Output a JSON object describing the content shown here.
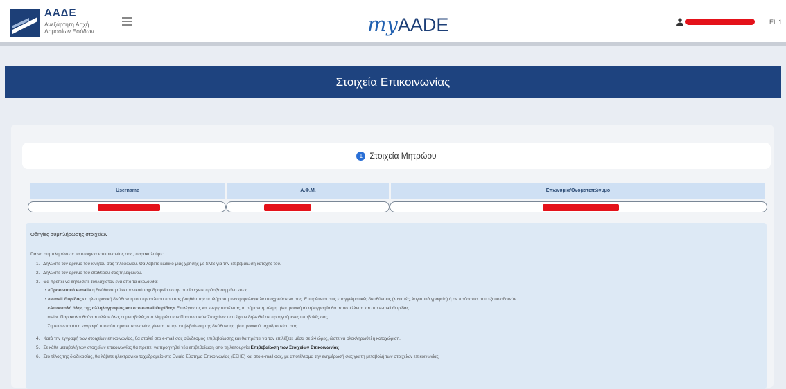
{
  "header": {
    "org_name": "ΑΑΔΕ",
    "org_line1": "Ανεξάρτητη Αρχή",
    "org_line2": "Δημοσίων Εσόδων",
    "brand_my": "my",
    "brand_aade": "AADE",
    "right_text": "EL 1"
  },
  "page": {
    "title": "Στοιχεία Επικοινωνίας"
  },
  "section": {
    "number": "1",
    "title": "Στοιχεία Μητρώου"
  },
  "table": {
    "headers": [
      "Username",
      "Α.Φ.Μ.",
      "Επωνυμία/Ονοματεπώνυμο"
    ]
  },
  "instructions": {
    "title": "Οδηγίες συμπλήρωσης στοιχείων",
    "intro": "Για να συμπληρώσετε τα στοιχεία επικοινωνίας σας, παρακαλούμε:",
    "items": [
      {
        "num": "1.",
        "text": "Δηλώστε τον αριθμό του κινητού σας τηλεφώνου. Θα λάβετε κωδικό μίας χρήσης με SMS για την επιβεβαίωση κατοχής του."
      },
      {
        "num": "2.",
        "text": "Δηλώστε τον αριθμό του σταθερού σας τηλεφώνου."
      },
      {
        "num": "3.",
        "text": "Θα πρέπει να δηλώσετε τουλάχιστον ένα από τα ακόλουθα:"
      }
    ],
    "sub_items": [
      {
        "bold": "«Προσωπικό e-mail»",
        "text": " η διεύθυνση ηλεκτρονικού ταχυδρομείου στην οποία έχετε πρόσβαση μόνο εσείς."
      },
      {
        "bold": "«e-mail Θυρίδας»",
        "text": " η ηλεκτρονική διεύθυνση του προσώπου που σας βοηθά στην εκπλήρωση των φορολογικών υποχρεώσεων σας. Επιτρέπεται στις επαγγελματικές διευθύνσεις (λογιστές, λογιστικά γραφεία) ή σε πρόσωπα που εξουσιοδοτείτε."
      },
      {
        "bold": "«Αποστολή όλης της αλληλογραφίας και στο e-mail Θυρίδας»",
        "text": " Επιλέγοντας και ενεργοποιώντας τη σήμανση, όλη η ηλεκτρονική αλληλογραφία θα αποστέλλεται και στο e-mail Θυρίδας."
      },
      {
        "bold": "",
        "text": "mail». Παρακολουθούνται πλέον όλες οι μεταβολές στο Μητρώο των Προσωπικών Στοιχείων που έχουν δηλωθεί σε προηγούμενες υποβολές σας."
      },
      {
        "bold": "",
        "text": "Σημειώνεται ότι η εγγραφή στο σύστημα επικοινωνίας γίνεται με την επιβεβαίωση της διεύθυνσης ηλεκτρονικού ταχυδρομείου σας."
      }
    ],
    "items_b": [
      {
        "num": "4.",
        "bold": "",
        "text": "Κατά την εγγραφή των στοιχείων επικοινωνίας, θα σταλεί στο e-mail σας σύνδεσμος επιβεβαίωσης και θα πρέπει να τον επιλέξετε μέσα σε 24 ώρες, ώστε να ολοκληρωθεί η καταχώριση."
      },
      {
        "num": "5.",
        "bold": "Επιβεβαίωση των Στοιχείων Επικοινωνίας",
        "text": "Σε κάθε μεταβολή των στοιχείων επικοινωνίας θα πρέπει να προηγηθεί νέα επιβεβαίωση από τη λειτουργία "
      },
      {
        "num": "6.",
        "bold": "",
        "text": "Στο τέλος της διαδικασίας, θα λάβετε ηλεκτρονικό ταχυδρομείο στο Ενιαίο Σύστημα Επικοινωνίας (ΕΣΗΕ) και στο e-mail σας, με αποτέλεσμα την ενημέρωσή σας για τη μεταβολή των στοιχείων επικοινωνίας."
      }
    ]
  }
}
